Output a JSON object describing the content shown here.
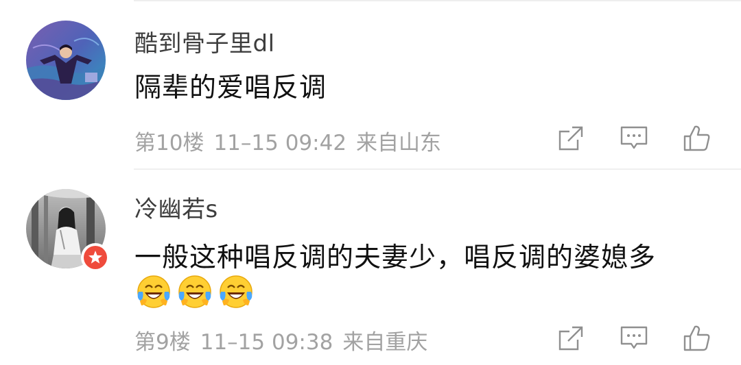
{
  "comments": [
    {
      "username": "酷到骨子里dl",
      "content": "隔辈的爱唱反调",
      "floor": "第10楼",
      "time": "11–15 09:42",
      "location": "来自山东",
      "emojis": [],
      "avatar_icon": "avatar-woman-in-robe",
      "verified_badge": false
    },
    {
      "username": "冷幽若s",
      "content": "一般这种唱反调的夫妻少，唱反调的婆媳多",
      "floor": "第9楼",
      "time": "11–15 09:38",
      "location": "来自重庆",
      "emojis": [
        "laugh-cry-emoji",
        "laugh-cry-emoji",
        "laugh-cry-emoji"
      ],
      "avatar_icon": "avatar-bw-photo",
      "verified_badge": true
    }
  ],
  "action_icons": [
    "share-icon",
    "reply-comment-icon",
    "like-thumb-icon"
  ],
  "colors": {
    "username": "#3d3d3d",
    "content": "#111111",
    "meta": "#a2a2a2",
    "icon": "#8f8f8f",
    "badge": "#ef4b3c",
    "emoji_face": "#ffcf33"
  }
}
